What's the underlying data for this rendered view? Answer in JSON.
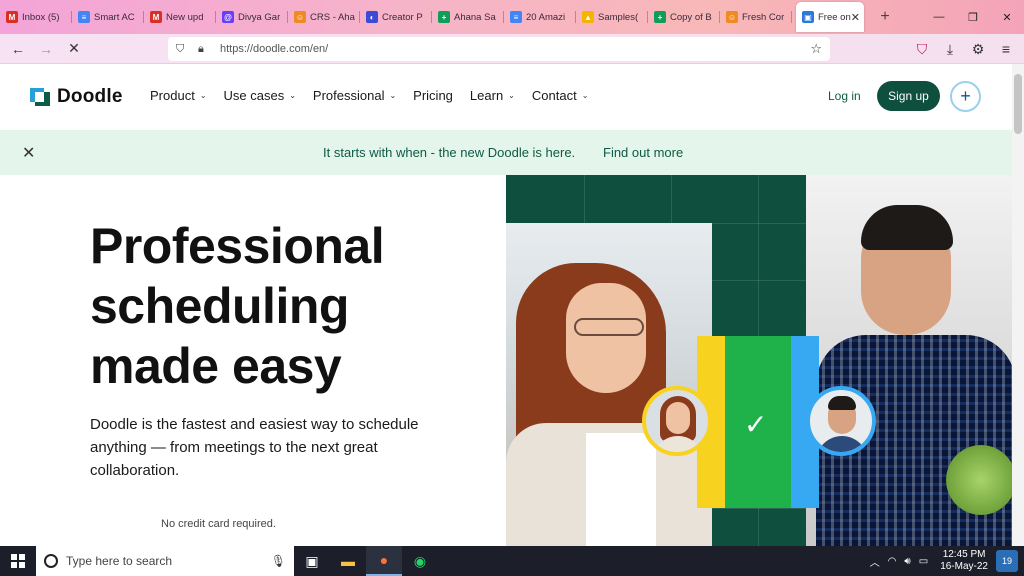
{
  "browser": {
    "tabs": [
      {
        "label": "Inbox (5)",
        "color": "#d93025",
        "glyph": "M"
      },
      {
        "label": "Smart AC",
        "color": "#4285f4",
        "glyph": "≡"
      },
      {
        "label": "New upd",
        "color": "#d93025",
        "glyph": "M"
      },
      {
        "label": "Divya Gar",
        "color": "#6a3cff",
        "glyph": "@"
      },
      {
        "label": "CRS - Aha",
        "color": "#f08a24",
        "glyph": "☺"
      },
      {
        "label": "Creator P",
        "color": "#3b4bd6",
        "glyph": "◐"
      },
      {
        "label": "Ahana Sa",
        "color": "#0f9d58",
        "glyph": "+"
      },
      {
        "label": "20 Amazi",
        "color": "#4285f4",
        "glyph": "≡"
      },
      {
        "label": "Samples(",
        "color": "#f4b400",
        "glyph": "▲"
      },
      {
        "label": "Copy of B",
        "color": "#0f9d58",
        "glyph": "+"
      },
      {
        "label": "Fresh Cor",
        "color": "#f08a24",
        "glyph": "☺"
      }
    ],
    "active_tab": {
      "label": "Free on",
      "close": "✕"
    },
    "new_tab": "+",
    "url": "https://doodle.com/en/"
  },
  "site": {
    "logo": "Doodle",
    "nav": [
      {
        "label": "Product",
        "dropdown": true
      },
      {
        "label": "Use cases",
        "dropdown": true
      },
      {
        "label": "Professional",
        "dropdown": true
      },
      {
        "label": "Pricing",
        "dropdown": false
      },
      {
        "label": "Learn",
        "dropdown": true
      },
      {
        "label": "Contact",
        "dropdown": true
      }
    ],
    "login": "Log in",
    "signup": "Sign up",
    "plus": "+"
  },
  "banner": {
    "message": "It starts with when - the new Doodle is here.",
    "link": "Find out more"
  },
  "hero": {
    "title_lines": [
      "Professional",
      "scheduling",
      "made easy"
    ],
    "subtitle": "Doodle is the fastest and easiest way to schedule anything — from meetings to the next great collaboration.",
    "note": "No credit card required."
  },
  "taskbar": {
    "search_placeholder": "Type here to search",
    "time": "12:45 PM",
    "date": "16-May-22",
    "notifications": "19"
  }
}
